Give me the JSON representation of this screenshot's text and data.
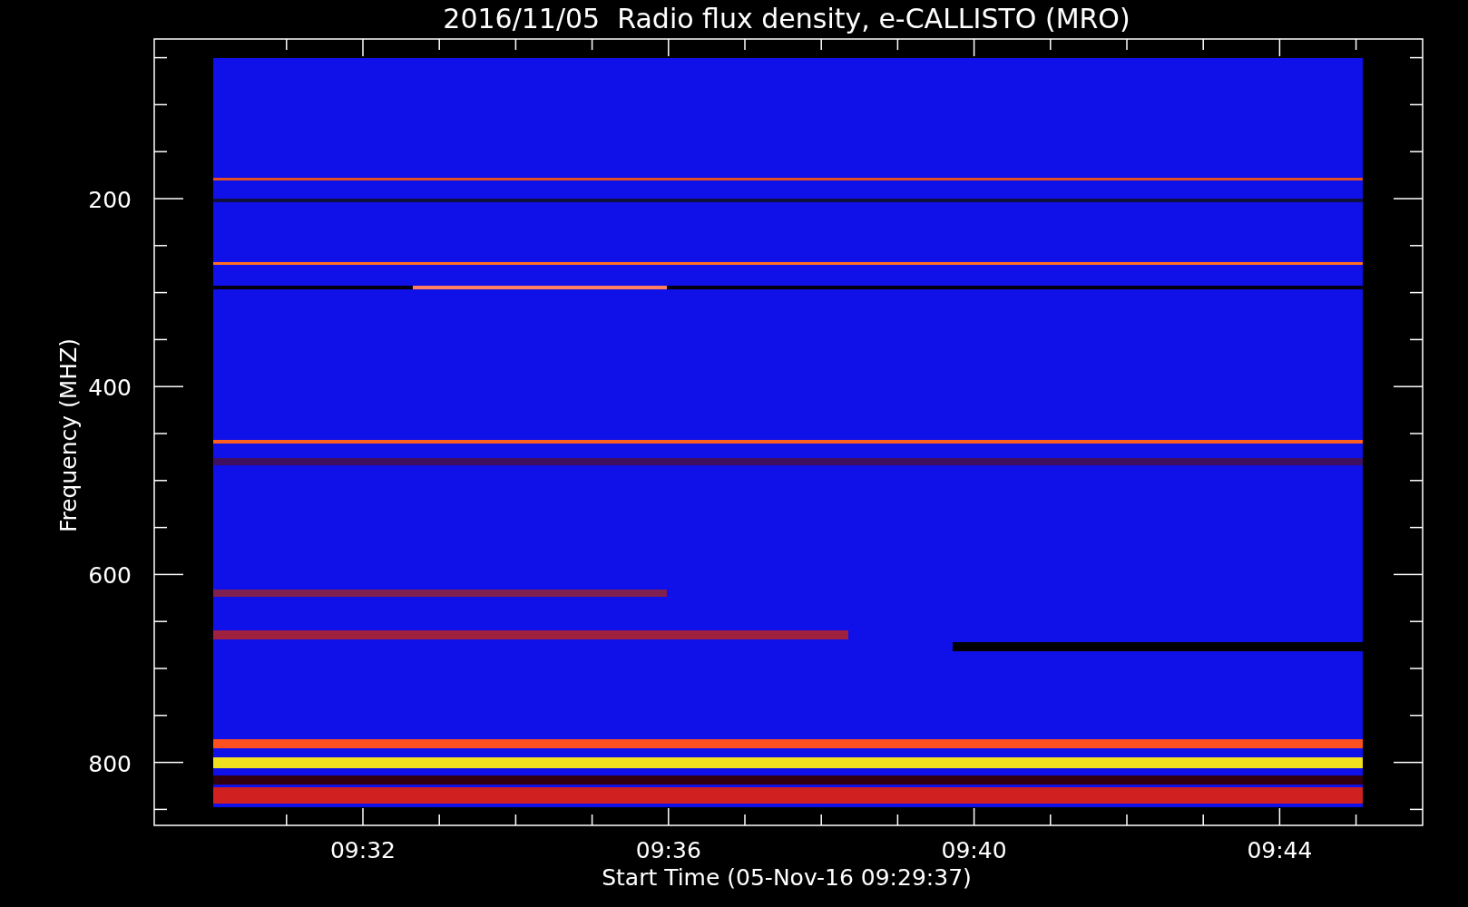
{
  "title": "2016/11/05  Radio flux density, e-CALLISTO (MRO)",
  "y_axis": {
    "label": "Frequency (MHZ)",
    "ticks": [
      "200",
      "400",
      "600",
      "800"
    ]
  },
  "x_axis": {
    "label": "Start Time (05-Nov-16 09:29:37)",
    "ticks": [
      "09:32",
      "09:36",
      "09:40",
      "09:44"
    ]
  }
}
